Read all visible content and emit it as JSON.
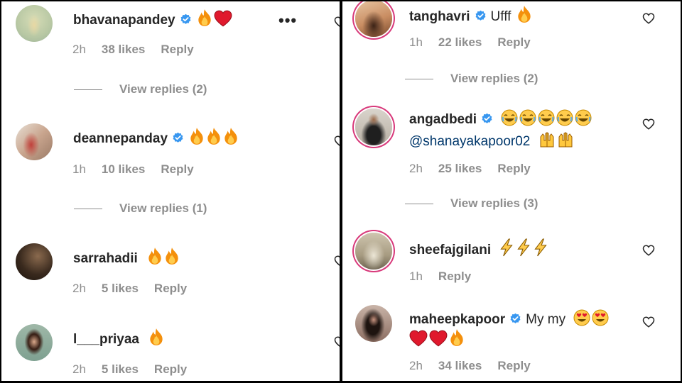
{
  "left": {
    "comments": [
      {
        "username": "bhavanapandey",
        "verified": true,
        "emojis": [
          "fire-icon",
          "heart-icon"
        ],
        "time": "2h",
        "likes": "38 likes",
        "reply": "Reply",
        "view_replies": "View replies (2)"
      },
      {
        "username": "deannepanday",
        "verified": true,
        "emojis": [
          "fire-icon",
          "fire-icon",
          "fire-icon"
        ],
        "time": "1h",
        "likes": "10 likes",
        "reply": "Reply",
        "view_replies": "View replies (1)"
      },
      {
        "username": "sarrahadii",
        "verified": false,
        "emojis": [
          "fire-icon",
          "fire-icon"
        ],
        "time": "2h",
        "likes": "5 likes",
        "reply": "Reply"
      },
      {
        "username": "l___priyaa",
        "verified": false,
        "emojis": [
          "fire-icon"
        ],
        "time": "2h",
        "likes": "5 likes",
        "reply": "Reply"
      }
    ]
  },
  "right": {
    "comments": [
      {
        "username": "tanghavri",
        "verified": true,
        "text": "Ufff",
        "emojis": [
          "fire-icon"
        ],
        "time": "1h",
        "likes": "22 likes",
        "reply": "Reply",
        "view_replies": "View replies (2)"
      },
      {
        "username": "angadbedi",
        "verified": true,
        "emojis": [
          "laughing-icon",
          "laughing-icon",
          "laughing-icon",
          "laughing-icon",
          "laughing-icon"
        ],
        "mention": "@shanayakapoor02",
        "emojis2": [
          "raising-hands-icon",
          "raising-hands-icon"
        ],
        "time": "2h",
        "likes": "25 likes",
        "reply": "Reply",
        "view_replies": "View replies (3)"
      },
      {
        "username": "sheefajgilani",
        "verified": false,
        "emojis": [
          "lightning-icon",
          "lightning-icon",
          "lightning-icon"
        ],
        "time": "1h",
        "reply": "Reply"
      },
      {
        "username": "maheepkapoor",
        "verified": true,
        "text": "My my",
        "emojis": [
          "heart-eyes-icon",
          "heart-eyes-icon"
        ],
        "emojis2": [
          "heart-icon",
          "heart-icon",
          "fire-icon"
        ],
        "time": "2h",
        "likes": "34 likes",
        "reply": "Reply"
      }
    ]
  },
  "colors": {
    "verified": "#3897f0",
    "ring": "#d83a7b",
    "meta": "#8e8e8e",
    "mention": "#00376b"
  }
}
